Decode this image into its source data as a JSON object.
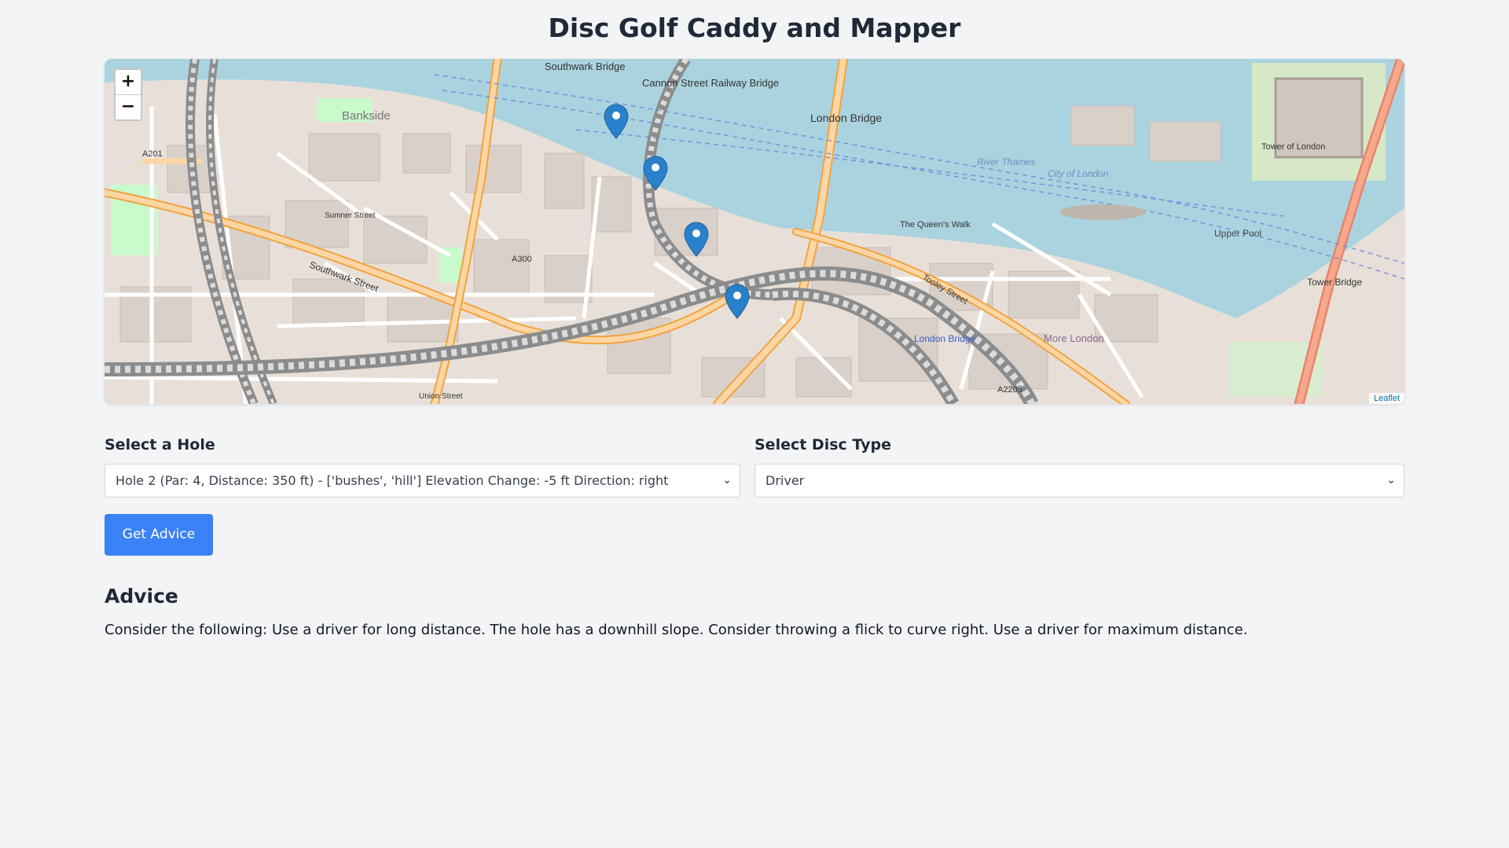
{
  "page": {
    "title": "Disc Golf Caddy and Mapper"
  },
  "map": {
    "zoom_in": "+",
    "zoom_out": "−",
    "attribution": "Leaflet",
    "place_labels": {
      "bankside": "Bankside",
      "southwark_bridge": "Southwark Bridge",
      "cannon_street_bridge": "Cannon Street Railway Bridge",
      "london_bridge": "London Bridge",
      "tower_of_london": "Tower of London",
      "river_thames": "River Thames",
      "city_of_london": "City of London",
      "upper_pool": "Upper Pool",
      "tower_bridge": "Tower Bridge",
      "more_london": "More London",
      "london_bridge_station": "London Bridge",
      "southwark_street": "Southwark Street",
      "a201": "A201",
      "a300": "A300",
      "a2205": "A2205",
      "the_queens_walk": "The Queen's Walk",
      "tooley_street": "Tooley Street",
      "sumner_street": "Sumner Street",
      "union_street": "Union Street"
    },
    "colors": {
      "water": "#aad3df",
      "land": "#e8e0d8",
      "park": "#c8facc",
      "major_road": "#fcd6a4",
      "primary_road": "#f7b04c",
      "railway": "#8c8c8c",
      "marker": "#2a81cb"
    }
  },
  "form": {
    "hole_label": "Select a Hole",
    "hole_selected": "Hole 2 (Par: 4, Distance: 350 ft) - ['bushes', 'hill'] Elevation Change: -5 ft Direction: right",
    "disc_label": "Select Disc Type",
    "disc_selected": "Driver",
    "button_label": "Get Advice"
  },
  "advice": {
    "title": "Advice",
    "text": "Consider the following: Use a driver for long distance. The hole has a downhill slope. Consider throwing a flick to curve right. Use a driver for maximum distance."
  }
}
